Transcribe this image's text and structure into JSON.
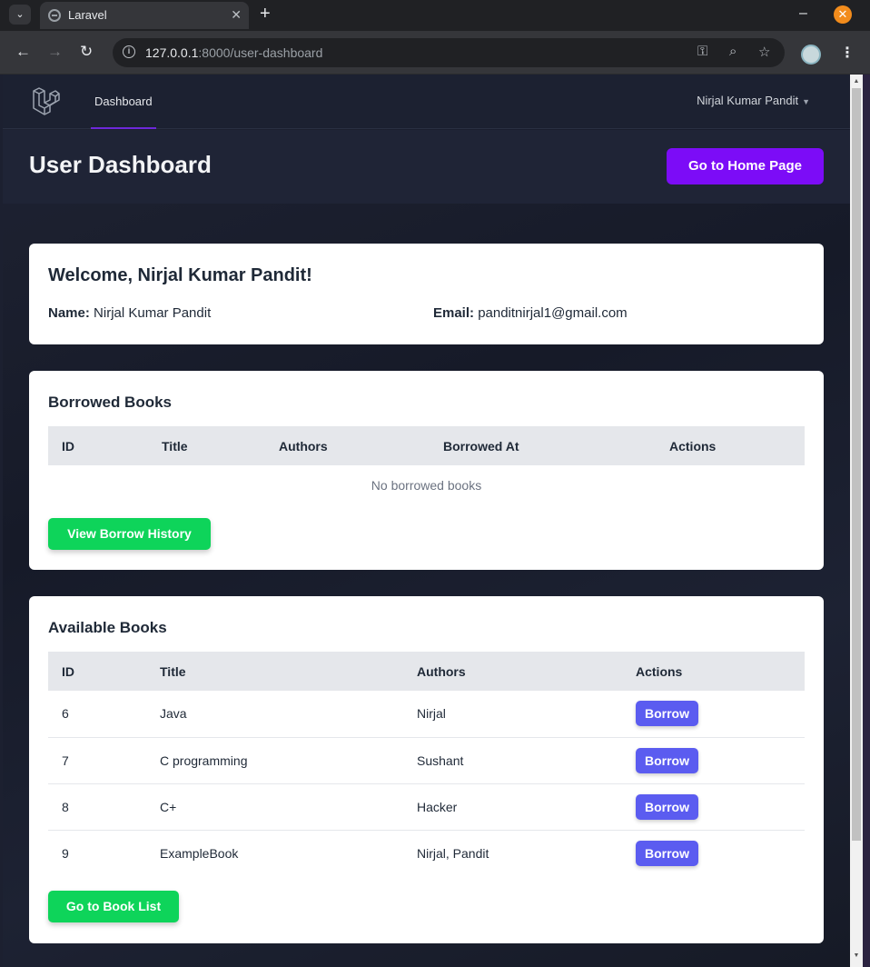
{
  "browser": {
    "tab_title": "Laravel",
    "url_host": "127.0.0.1",
    "url_rest": ":8000/user-dashboard"
  },
  "nav": {
    "dashboard_link": "Dashboard",
    "user_name": "Nirjal Kumar Pandit"
  },
  "header": {
    "title": "User Dashboard",
    "home_button": "Go to Home Page"
  },
  "welcome": {
    "title": "Welcome, Nirjal Kumar Pandit!",
    "name_label": "Name:",
    "name_value": "Nirjal Kumar Pandit",
    "email_label": "Email:",
    "email_value": "panditnirjal1@gmail.com"
  },
  "borrowed": {
    "title": "Borrowed Books",
    "columns": [
      "ID",
      "Title",
      "Authors",
      "Borrowed At",
      "Actions"
    ],
    "empty_text": "No borrowed books",
    "history_button": "View Borrow History"
  },
  "available": {
    "title": "Available Books",
    "columns": [
      "ID",
      "Title",
      "Authors",
      "Actions"
    ],
    "rows": [
      {
        "id": "6",
        "title": "Java",
        "authors": "Nirjal",
        "action": "Borrow"
      },
      {
        "id": "7",
        "title": "C programming",
        "authors": "Sushant",
        "action": "Borrow"
      },
      {
        "id": "8",
        "title": "C+",
        "authors": "Hacker",
        "action": "Borrow"
      },
      {
        "id": "9",
        "title": "ExampleBook",
        "authors": "Nirjal, Pandit",
        "action": "Borrow"
      }
    ],
    "book_list_button": "Go to Book List"
  },
  "colors": {
    "primary": "#7c0cf7",
    "borrow": "#5b5cf0",
    "success": "#0ed45a"
  }
}
